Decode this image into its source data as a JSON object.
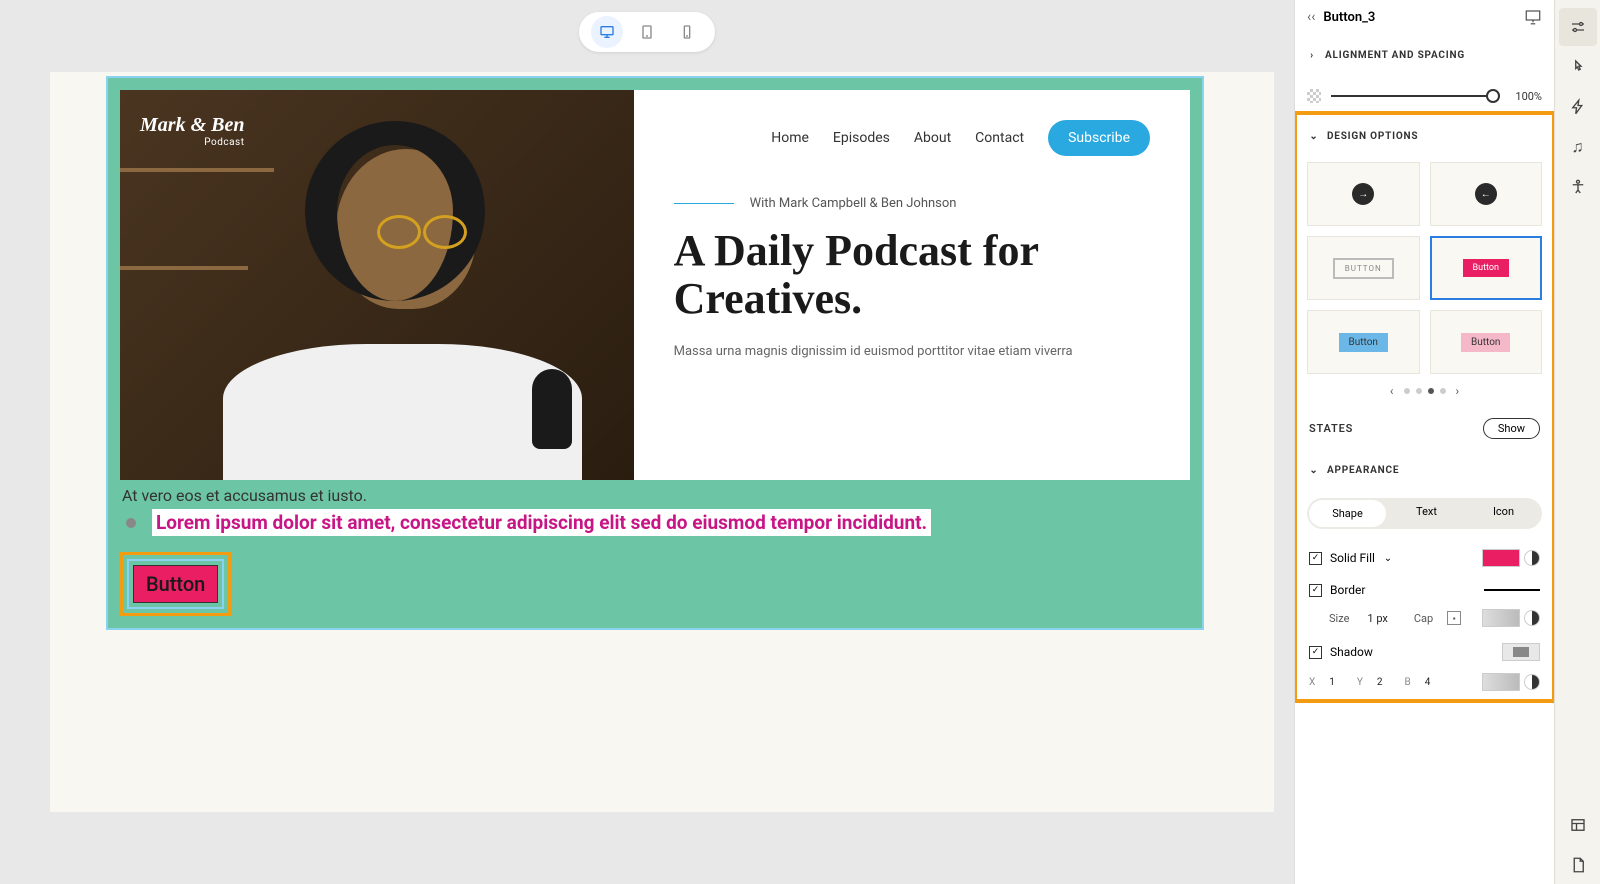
{
  "element_name": "Button_3",
  "device": {
    "active": "desktop"
  },
  "canvas": {
    "logo": {
      "main": "Mark & Ben",
      "sub": "Podcast"
    },
    "nav": {
      "home": "Home",
      "episodes": "Episodes",
      "about": "About",
      "contact": "Contact",
      "subscribe": "Subscribe"
    },
    "tagline": "With Mark Campbell & Ben Johnson",
    "hero_title": "A Daily Podcast for Creatives.",
    "hero_desc": "Massa urna magnis dignissim id euismod porttitor vitae etiam viverra",
    "text1": "At vero eos et accusamus et iusto.",
    "text2": "Lorem ipsum dolor sit amet, consectetur adipiscing elit sed do eiusmod tempor incididunt.",
    "button_label": "Button"
  },
  "panel": {
    "sections": {
      "alignment": "Alignment and Spacing",
      "design": "Design Options",
      "appearance": "Appearance"
    },
    "opacity": "100%",
    "design_options": {
      "opt3_label": "BUTTON",
      "opt4_label": "Button",
      "opt5_label": "Button",
      "opt6_label": "Button"
    },
    "states": {
      "label": "States",
      "show": "Show"
    },
    "tabs": {
      "shape": "Shape",
      "text": "Text",
      "icon": "Icon",
      "active": "shape"
    },
    "fill": {
      "label": "Solid Fill",
      "color": "#e91e63"
    },
    "border": {
      "label": "Border",
      "size_label": "Size",
      "size_value": "1 px",
      "cap_label": "Cap"
    },
    "shadow": {
      "label": "Shadow",
      "x": "1",
      "y": "2",
      "b": "4"
    }
  }
}
